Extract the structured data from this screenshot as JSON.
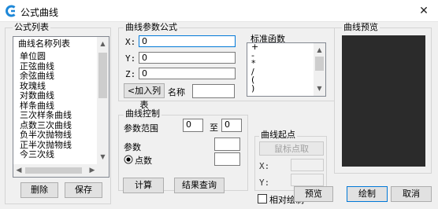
{
  "window": {
    "title": "公式曲线",
    "close_glyph": "✕"
  },
  "formula_list": {
    "legend": "公式列表",
    "header": "曲线名称列表",
    "items": [
      "单位圆",
      "正弦曲线",
      "余弦曲线",
      "玫瑰线",
      "对数曲线",
      "样条曲线",
      "三次样条曲线",
      "点数三次曲线",
      "负半次抛物线",
      "正半次抛物线",
      "今三次线"
    ],
    "delete_label": "删除",
    "save_label": "保存"
  },
  "params": {
    "legend": "曲线参数公式",
    "x_label": "X:",
    "x_value": "0",
    "y_label": "Y:",
    "y_value": "0",
    "z_label": "Z:",
    "z_value": "0",
    "add_list_label": "<加入列表",
    "name_label": "名称",
    "name_value": ""
  },
  "std_functions": {
    "legend": "标准函数",
    "items": [
      "+",
      "-",
      "*",
      "/",
      "(",
      ")"
    ]
  },
  "control": {
    "legend": "曲线控制",
    "range_label": "参数范围",
    "range_from": "0",
    "range_to_label": "至",
    "range_to": "0",
    "param_label": "参数",
    "param_value": "",
    "points_label": "点数",
    "points_value": "",
    "points_checked": true
  },
  "start_point": {
    "legend": "曲线起点",
    "pick_label": "鼠标点取",
    "x_label": "X:",
    "x_value": "",
    "y_label": "Y:",
    "y_value": "",
    "relative_label": "相对绘制",
    "relative_checked": false
  },
  "preview": {
    "legend": "曲线预览",
    "background_color": "#2b2b2b"
  },
  "actions": {
    "calculate_label": "计算",
    "query_label": "结果查询",
    "preview_label": "预览",
    "draw_label": "绘制",
    "cancel_label": "取消"
  },
  "colors": {
    "accent": "#0078d7",
    "dialog_bg": "#f0f0f0"
  }
}
